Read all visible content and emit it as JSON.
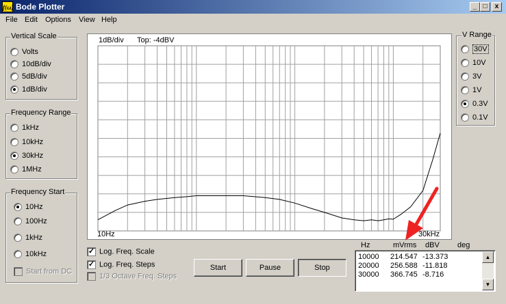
{
  "window": {
    "title": "Bode Plotter",
    "app_icon": "f(ω)",
    "minimize": "_",
    "maximize": "□",
    "close": "x"
  },
  "menu": [
    "File",
    "Edit",
    "Options",
    "View",
    "Help"
  ],
  "vertical_scale": {
    "label": "Vertical Scale",
    "options": [
      "Volts",
      "10dB/div",
      "5dB/div",
      "1dB/div"
    ],
    "selected": 3
  },
  "frequency_range": {
    "label": "Frequency Range",
    "options": [
      "1kHz",
      "10kHz",
      "30kHz",
      "1MHz"
    ],
    "selected": 2
  },
  "frequency_start": {
    "label": "Frequency Start",
    "options": [
      "10Hz",
      "100Hz",
      "1kHz",
      "10kHz"
    ],
    "selected": 0,
    "from_dc": "Start from DC"
  },
  "v_range": {
    "label": "V Range",
    "options": [
      "30V",
      "10V",
      "3V",
      "1V",
      "0.3V",
      "0.1V"
    ],
    "selected": 4
  },
  "plot": {
    "scale_label": "1dB/div",
    "top_label": "Top: -4dBV",
    "x_start_label": "10Hz",
    "x_end_label": "30kHz"
  },
  "chart_data": {
    "type": "line",
    "x_scale": "log",
    "xlim": [
      10,
      30000
    ],
    "ylim": [
      -14,
      -4
    ],
    "grid": true,
    "x": [
      10,
      15,
      20,
      30,
      40,
      60,
      80,
      100,
      150,
      200,
      300,
      500,
      700,
      1000,
      1500,
      2000,
      3000,
      4000,
      5000,
      6000,
      7000,
      8000,
      9000,
      10000,
      12000,
      15000,
      20000,
      25000,
      30000
    ],
    "y": [
      -13.4,
      -12.9,
      -12.6,
      -12.4,
      -12.3,
      -12.2,
      -12.15,
      -12.1,
      -12.1,
      -12.1,
      -12.1,
      -12.2,
      -12.3,
      -12.5,
      -12.8,
      -13.0,
      -13.3,
      -13.4,
      -13.45,
      -13.4,
      -13.45,
      -13.4,
      -13.35,
      -13.37,
      -13.1,
      -12.7,
      -11.82,
      -10.2,
      -8.72
    ]
  },
  "options": {
    "log_freq_scale": {
      "label": "Log. Freq. Scale",
      "checked": true
    },
    "log_freq_steps": {
      "label": "Log. Freq. Steps",
      "checked": true
    },
    "octave_steps": {
      "label": "1/3 Octave Freq. Steps",
      "checked": false,
      "disabled": true
    }
  },
  "buttons": {
    "start": "Start",
    "pause": "Pause",
    "stop": "Stop"
  },
  "readout": {
    "columns": [
      "Hz",
      "mVrms",
      "dBV",
      "deg"
    ],
    "rows": [
      [
        "10000",
        "214.547",
        "-13.373"
      ],
      [
        "20000",
        "256.588",
        "-11.818"
      ],
      [
        "30000",
        "366.745",
        "-8.716"
      ]
    ]
  },
  "colors": {
    "annotation_arrow": "#ee2222",
    "title_bar": "#0a246a"
  }
}
